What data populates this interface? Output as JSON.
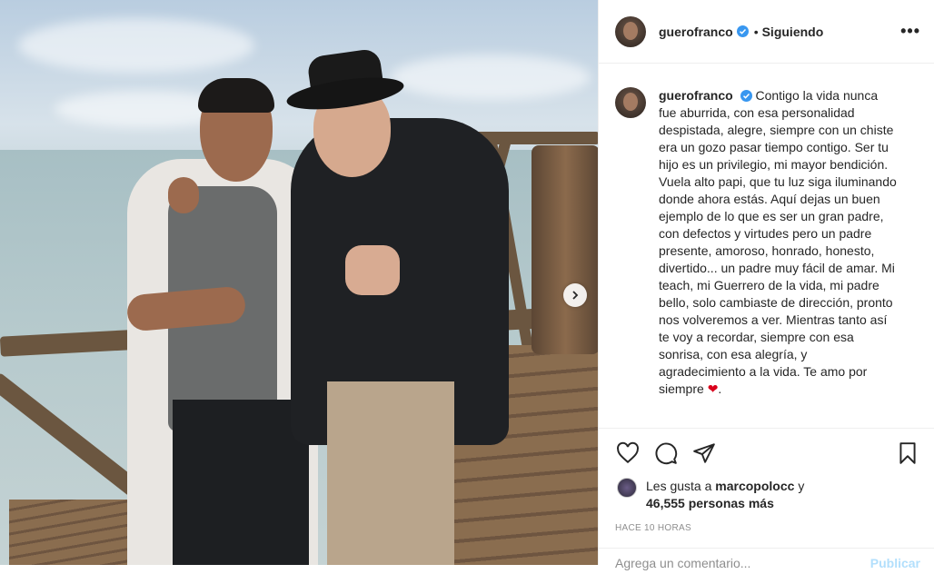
{
  "post": {
    "username": "guerofranco",
    "follow_status": "Siguiendo",
    "separator": "•",
    "more_label": "•••",
    "caption": "Contigo la vida nunca fue aburrida, con esa personalidad despistada, alegre, siempre con un chiste era un gozo pasar tiempo contigo. Ser tu hijo es un privilegio, mi mayor bendición. Vuela alto papi, que tu luz siga iluminando donde ahora estás. Aquí dejas un buen ejemplo de lo que es ser un gran padre, con defectos y virtudes pero un padre presente, amoroso, honrado, honesto, divertido... un padre muy fácil de amar. Mi teach, mi Guerrero de la vida, mi padre bello, solo cambiaste de dirección, pronto nos volveremos a ver. Mientras tanto así te voy a recordar, siempre con esa sonrisa, con esa alegría, y agradecimiento a la vida. Te amo por siempre",
    "caption_emoji": "❤",
    "caption_end": ".",
    "likes_prefix": "Les gusta a",
    "likes_user": "marcopolocc",
    "likes_connector": "y",
    "likes_count": "46,555 personas más",
    "time_ago": "HACE 10 HORAS",
    "comment_placeholder": "Agrega un comentario...",
    "post_button": "Publicar"
  },
  "icons": {
    "like": "heart-icon",
    "comment": "comment-icon",
    "share": "share-icon",
    "save": "bookmark-icon",
    "verified": "verified-badge-icon",
    "next": "chevron-right-icon"
  },
  "colors": {
    "verified": "#3897f0",
    "text": "#262626",
    "muted": "#8e8e8e",
    "post_button": "#b2dffc"
  }
}
